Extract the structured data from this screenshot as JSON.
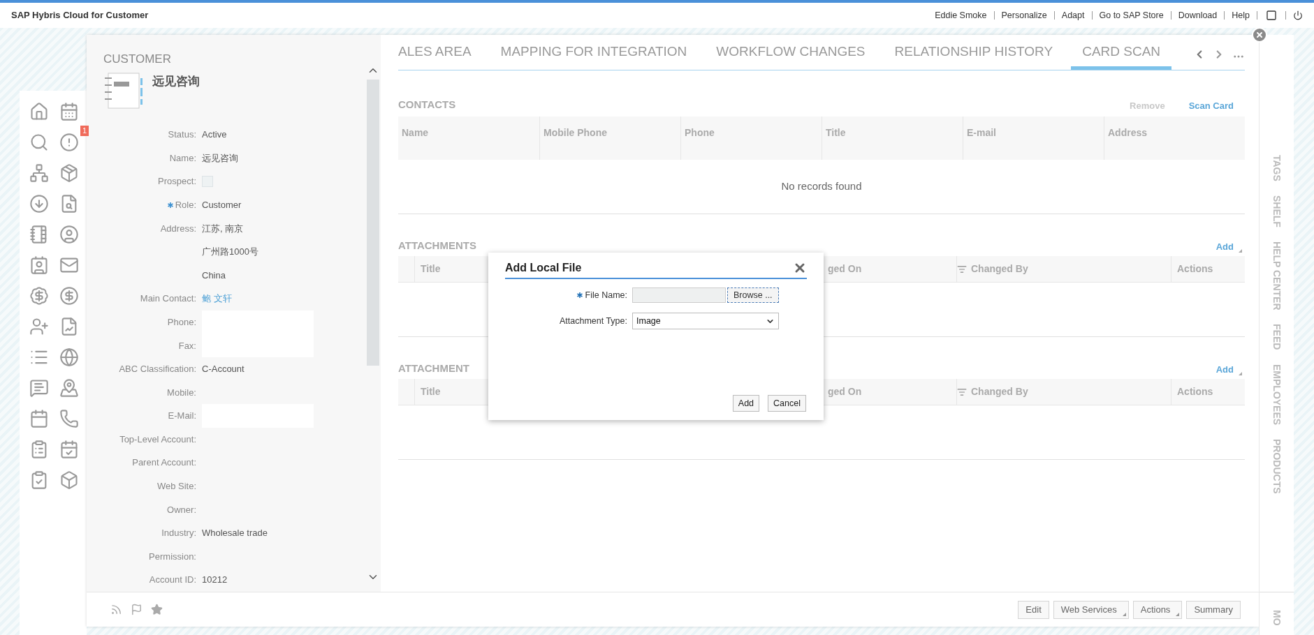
{
  "app": {
    "title": "SAP Hybris Cloud for Customer",
    "links": [
      "Eddie Smoke",
      "Personalize",
      "Adapt",
      "Go to SAP Store",
      "Download",
      "Help"
    ]
  },
  "nav": {
    "badge": "1"
  },
  "customer": {
    "heading": "CUSTOMER",
    "name": "远见咨询",
    "fields": [
      {
        "label": "Status:",
        "kind": "text",
        "value": "Active",
        "required": false
      },
      {
        "label": "Name:",
        "kind": "text",
        "value": "远见咨询",
        "required": false
      },
      {
        "label": "Prospect:",
        "kind": "checkbox",
        "checked": false,
        "required": false
      },
      {
        "label": "Role:",
        "kind": "text",
        "value": "Customer",
        "required": true
      },
      {
        "label": "Address:",
        "kind": "text",
        "value": "江苏, 南京",
        "required": false
      },
      {
        "kind": "text",
        "value": "广州路1000号",
        "required": false
      },
      {
        "kind": "text",
        "value": "China",
        "required": false
      },
      {
        "label": "Main Contact:",
        "kind": "link",
        "value": "鲍 文轩",
        "required": false
      },
      {
        "label": "Phone:",
        "kind": "redacted",
        "required": false
      },
      {
        "label": "Fax:",
        "kind": "redacted",
        "required": false
      },
      {
        "label": "ABC Classification:",
        "kind": "text",
        "value": "C-Account",
        "required": false
      },
      {
        "label": "Mobile:",
        "kind": "empty",
        "required": false
      },
      {
        "label": "E-Mail:",
        "kind": "redacted",
        "required": false
      },
      {
        "label": "Top-Level Account:",
        "kind": "empty",
        "required": false
      },
      {
        "label": "Parent Account:",
        "kind": "empty",
        "required": false
      },
      {
        "label": "Web Site:",
        "kind": "empty",
        "required": false
      },
      {
        "label": "Owner:",
        "kind": "empty",
        "required": false
      },
      {
        "label": "Industry:",
        "kind": "text",
        "value": "Wholesale trade",
        "required": false
      },
      {
        "label": "Permission:",
        "kind": "empty",
        "required": false
      },
      {
        "label": "Account ID:",
        "kind": "text",
        "value": "10212",
        "required": false
      }
    ]
  },
  "tabs": [
    {
      "label": "ALES AREA",
      "selected": false
    },
    {
      "label": "MAPPING FOR INTEGRATION",
      "selected": false
    },
    {
      "label": "WORKFLOW CHANGES",
      "selected": false
    },
    {
      "label": "RELATIONSHIP HISTORY",
      "selected": false
    },
    {
      "label": "CARD SCAN",
      "selected": true
    }
  ],
  "sections": [
    {
      "kind": "contacts",
      "title": "CONTACTS",
      "actions": [
        {
          "label": "Remove",
          "disabled": true
        },
        {
          "label": "Scan Card",
          "disabled": false
        }
      ],
      "columns": [
        "Name",
        "Mobile Phone",
        "Phone",
        "Title",
        "E-mail",
        "Address"
      ],
      "empty_text": "No records found"
    },
    {
      "kind": "attachments",
      "title": "ATTACHMENTS",
      "actions": [
        {
          "label": "Add",
          "disabled": false
        }
      ],
      "columns": [
        {
          "label": "Title",
          "filter": false
        },
        {
          "label": "ged On",
          "filter": false
        },
        {
          "label": "Changed By",
          "filter": true
        },
        {
          "label": "Actions",
          "filter": false
        }
      ]
    },
    {
      "kind": "attachments",
      "title": "ATTACHMENT",
      "actions": [
        {
          "label": "Add",
          "disabled": false
        }
      ],
      "columns": [
        {
          "label": "Title",
          "filter": false
        },
        {
          "label": "ged On",
          "filter": false
        },
        {
          "label": "Changed By",
          "filter": true
        },
        {
          "label": "Actions",
          "filter": false
        }
      ]
    }
  ],
  "footer_buttons": [
    {
      "label": "Edit",
      "menu": false
    },
    {
      "label": "Web Services",
      "menu": true
    },
    {
      "label": "Actions",
      "menu": true
    },
    {
      "label": "Summary",
      "menu": false
    }
  ],
  "side_panels": [
    "TAGS",
    "SHELF",
    "HELP CENTER",
    "FEED",
    "EMPLOYEES",
    "PRODUCTS"
  ],
  "side_more": "MO",
  "dialog": {
    "title": "Add Local File",
    "fields": [
      {
        "label": "File Name:",
        "kind": "file",
        "required": true,
        "button": "Browse ..."
      },
      {
        "label": "Attachment Type:",
        "kind": "select",
        "required": false,
        "value": "Image"
      }
    ],
    "buttons": [
      "Add",
      "Cancel"
    ]
  }
}
